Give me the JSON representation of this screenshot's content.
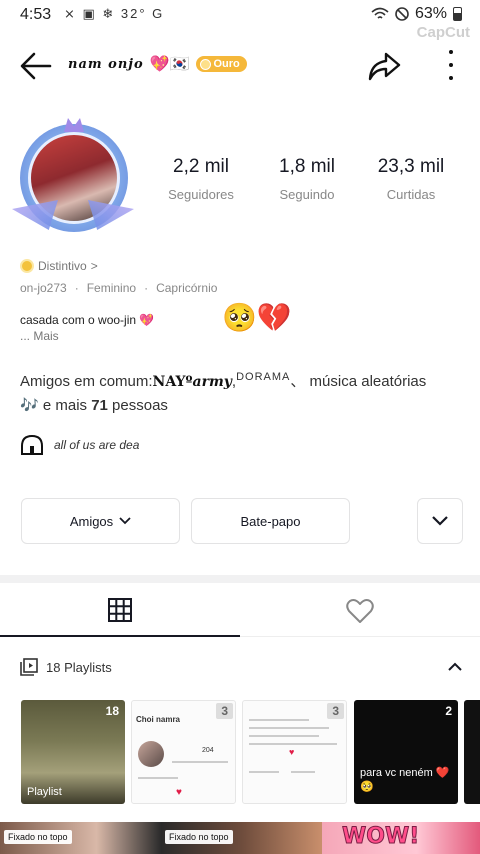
{
  "status_bar": {
    "time": "4:53",
    "left_icons": "⨯ ▣ ❄ 32° G",
    "battery": "63%"
  },
  "watermark": "CapCut",
  "header": {
    "username": "nam onjo",
    "emoji": "💖🇰🇷",
    "badge": "Ouro"
  },
  "stats": {
    "followers": {
      "value": "2,2 mil",
      "label": "Seguidores"
    },
    "following": {
      "value": "1,8 mil",
      "label": "Seguindo"
    },
    "likes": {
      "value": "23,3 mil",
      "label": "Curtidas"
    }
  },
  "bio": {
    "distinctive": "Distintivo",
    "distinctive_arrow": ">",
    "handle": "on-jo273",
    "gender": "Feminino",
    "sign": "Capricórnio",
    "separator": "·",
    "text": "casada com o woo-jin 💖",
    "more": "... Mais",
    "emoji": "🥺💔"
  },
  "common_friends": {
    "prefix": "Amigos em comum:",
    "name1": "NAYº",
    "name1b": "army",
    "name2": "DORAMA",
    "sep": "、",
    "name3": " música aleatórias",
    "note": "🎶",
    "suffix": " e mais ",
    "count": "71",
    "suffix2": " pessoas"
  },
  "link": {
    "text": "all of us are dea"
  },
  "buttons": {
    "friends": "Amigos",
    "chat": "Bate-papo"
  },
  "playlists": {
    "header": "18 Playlists",
    "cards": [
      {
        "count": "18",
        "caption": "Playlist"
      },
      {
        "count": "3",
        "title": "Choi namra",
        "stat1": "204"
      },
      {
        "count": "3"
      },
      {
        "count": "2",
        "caption": "para vc neném ❤️🥺"
      }
    ]
  },
  "bottom": {
    "pin1": "Fixado no topo",
    "pin2": "Fixado no topo",
    "wow": "WOW!"
  },
  "colors": {
    "text": "#161823",
    "muted": "#888888",
    "badge": "#f5b83a",
    "divider": "#f1f1f2"
  }
}
